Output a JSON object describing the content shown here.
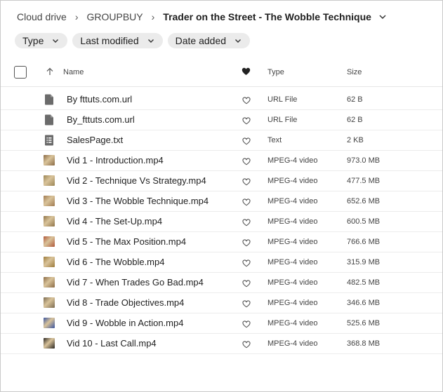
{
  "breadcrumb": {
    "items": [
      "Cloud drive",
      "GROUPBUY"
    ],
    "current": "Trader on the Street - The Wobble Technique"
  },
  "filters": [
    {
      "label": "Type"
    },
    {
      "label": "Last modified"
    },
    {
      "label": "Date added"
    }
  ],
  "columns": {
    "name": "Name",
    "type": "Type",
    "size": "Size"
  },
  "files": [
    {
      "name": "By fttuts.com.url",
      "type": "URL File",
      "size": "62 B",
      "icon": "generic-file-icon",
      "thumb": null
    },
    {
      "name": "By_fttuts.com.url",
      "type": "URL File",
      "size": "62 B",
      "icon": "generic-file-icon",
      "thumb": null
    },
    {
      "name": "SalesPage.txt",
      "type": "Text",
      "size": "2 KB",
      "icon": "text-file-icon",
      "thumb": null
    },
    {
      "name": "Vid 1 - Introduction.mp4",
      "type": "MPEG-4 video",
      "size": "973.0 MB",
      "icon": "video-thumbnail",
      "thumb": "#8a6a45"
    },
    {
      "name": "Vid 2 - Technique Vs Strategy.mp4",
      "type": "MPEG-4 video",
      "size": "477.5 MB",
      "icon": "video-thumbnail",
      "thumb": "#9a8555"
    },
    {
      "name": "Vid 3 - The Wobble Technique.mp4",
      "type": "MPEG-4 video",
      "size": "652.6 MB",
      "icon": "video-thumbnail",
      "thumb": "#a07a50"
    },
    {
      "name": "Vid 4 - The Set-Up.mp4",
      "type": "MPEG-4 video",
      "size": "600.5 MB",
      "icon": "video-thumbnail",
      "thumb": "#8f7448"
    },
    {
      "name": "Vid 5 - The Max Position.mp4",
      "type": "MPEG-4 video",
      "size": "766.6 MB",
      "icon": "video-thumbnail",
      "thumb": "#b0583a"
    },
    {
      "name": "Vid 6 - The Wobble.mp4",
      "type": "MPEG-4 video",
      "size": "315.9 MB",
      "icon": "video-thumbnail",
      "thumb": "#9c7a3a"
    },
    {
      "name": "Vid 7 - When Trades Go Bad.mp4",
      "type": "MPEG-4 video",
      "size": "482.5 MB",
      "icon": "video-thumbnail",
      "thumb": "#8a6a45"
    },
    {
      "name": "Vid 8 - Trade Objectives.mp4",
      "type": "MPEG-4 video",
      "size": "346.6 MB",
      "icon": "video-thumbnail",
      "thumb": "#7a6a50"
    },
    {
      "name": "Vid 9 - Wobble in Action.mp4",
      "type": "MPEG-4 video",
      "size": "525.6 MB",
      "icon": "video-thumbnail",
      "thumb": "#3a55a0"
    },
    {
      "name": "Vid 10 - Last Call.mp4",
      "type": "MPEG-4 video",
      "size": "368.8 MB",
      "icon": "video-thumbnail",
      "thumb": "#2a2622"
    }
  ],
  "colors": {
    "icon_gray": "#6b6b6b",
    "chip_bg": "#ebebeb",
    "text": "#1f1f1f",
    "muted": "#444444"
  }
}
